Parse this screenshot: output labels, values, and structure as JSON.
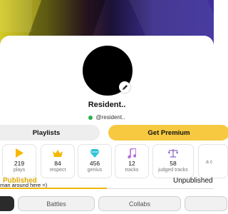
{
  "profile": {
    "name": "Resident..",
    "handle": "@resident..",
    "status_color": "#2bb24c"
  },
  "actions": {
    "playlists_label": "Playlists",
    "premium_label": "Get Premium"
  },
  "stats": [
    {
      "icon": "play-icon",
      "value": "219",
      "label": "plays"
    },
    {
      "icon": "crown-icon",
      "value": "84",
      "label": "respect"
    },
    {
      "icon": "diamond-icon",
      "value": "456",
      "label": "genius"
    },
    {
      "icon": "music-note-icon",
      "value": "12",
      "label": "tracks"
    },
    {
      "icon": "scales-icon",
      "value": "58",
      "label": "judged tracks"
    },
    {
      "icon": "unknown-icon",
      "value": "",
      "label": "a c"
    }
  ],
  "bio": "man around here =)",
  "tabs": {
    "published": "Published",
    "unpublished": "Unpublished"
  },
  "filters": [
    "Battles",
    "Collabs"
  ],
  "colors": {
    "accent": "#f6c940",
    "tab_active": "#f0b400",
    "play_icon": "#f5b800",
    "crown_icon": "#f5b800",
    "diamond_icon": "#2ec4d6",
    "note_icon": "#b36ad9",
    "scales_icon": "#8a63c7"
  }
}
